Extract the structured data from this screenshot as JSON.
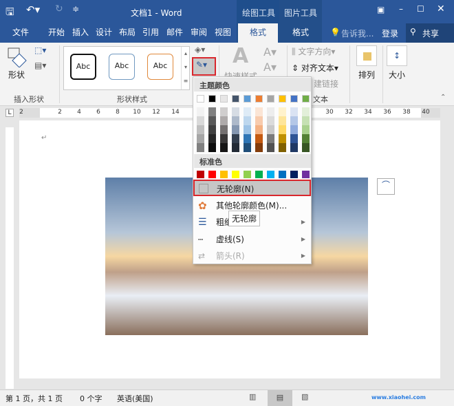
{
  "title": "文档1 - Word",
  "context_tabs": [
    "绘图工具",
    "图片工具"
  ],
  "tabs": [
    "文件",
    "开始",
    "插入",
    "设计",
    "布局",
    "引用",
    "邮件",
    "审阅",
    "视图",
    "格式",
    "格式"
  ],
  "tell_me": "告诉我...",
  "login": "登录",
  "share": "共享",
  "ribbon": {
    "shape_btn": "形状",
    "insert_shapes_group": "插入形状",
    "style_samples": [
      "Abc",
      "Abc",
      "Abc"
    ],
    "shape_styles_group": "形状样式",
    "quick_styles": "快速样式",
    "text_direction": "文字方向",
    "align_text": "对齐文本",
    "create_link": "建链接",
    "text_group": "文本",
    "arrange": "排列",
    "size": "大小"
  },
  "ruler_numbers": [
    "2",
    "2",
    "4",
    "6",
    "8",
    "10",
    "12",
    "14",
    "30",
    "32",
    "34",
    "36",
    "38",
    "40"
  ],
  "menu": {
    "theme_colors_label": "主题颜色",
    "theme_colors": [
      "#ffffff",
      "#000000",
      "#e7e6e6",
      "#44546a",
      "#5b9bd5",
      "#ed7d31",
      "#a5a5a5",
      "#ffc000",
      "#4472c4",
      "#70ad47"
    ],
    "theme_shades": [
      [
        "#f2f2f2",
        "#d9d9d9",
        "#bfbfbf",
        "#a6a6a6",
        "#808080"
      ],
      [
        "#808080",
        "#595959",
        "#404040",
        "#262626",
        "#0d0d0d"
      ],
      [
        "#d0cece",
        "#aeaaaa",
        "#757171",
        "#3a3838",
        "#171616"
      ],
      [
        "#d6dce4",
        "#adb9ca",
        "#8496b0",
        "#333f4f",
        "#222a35"
      ],
      [
        "#deebf6",
        "#bdd7ee",
        "#9dc3e6",
        "#2e75b5",
        "#1f4e79"
      ],
      [
        "#fbe5d5",
        "#f8cbad",
        "#f4b183",
        "#c55a11",
        "#843c0b"
      ],
      [
        "#ededed",
        "#dbdbdb",
        "#c9c9c9",
        "#7b7b7b",
        "#525252"
      ],
      [
        "#fff2cc",
        "#fee599",
        "#ffd965",
        "#bf9000",
        "#7f6000"
      ],
      [
        "#dae3f3",
        "#b4c7e7",
        "#8faadc",
        "#2f5496",
        "#1f3864"
      ],
      [
        "#e2efd9",
        "#c5e0b3",
        "#a8d08d",
        "#538135",
        "#375623"
      ]
    ],
    "standard_colors_label": "标准色",
    "standard_colors": [
      "#c00000",
      "#ff0000",
      "#ffc000",
      "#ffff00",
      "#92d050",
      "#00b050",
      "#00b0f0",
      "#0070c0",
      "#002060",
      "#7030a0"
    ],
    "items": [
      "无轮廓(N)",
      "其他轮廓颜色(M)...",
      "粗细(W)",
      "虚线(S)",
      "箭头(R)"
    ],
    "tooltip": "无轮廓"
  },
  "status": {
    "page": "第 1 页，共 1 页",
    "words": "0 个字",
    "lang": "英语(美国)"
  },
  "watermark": "www.xiaohei.com",
  "highlight_color": "#d9262c"
}
